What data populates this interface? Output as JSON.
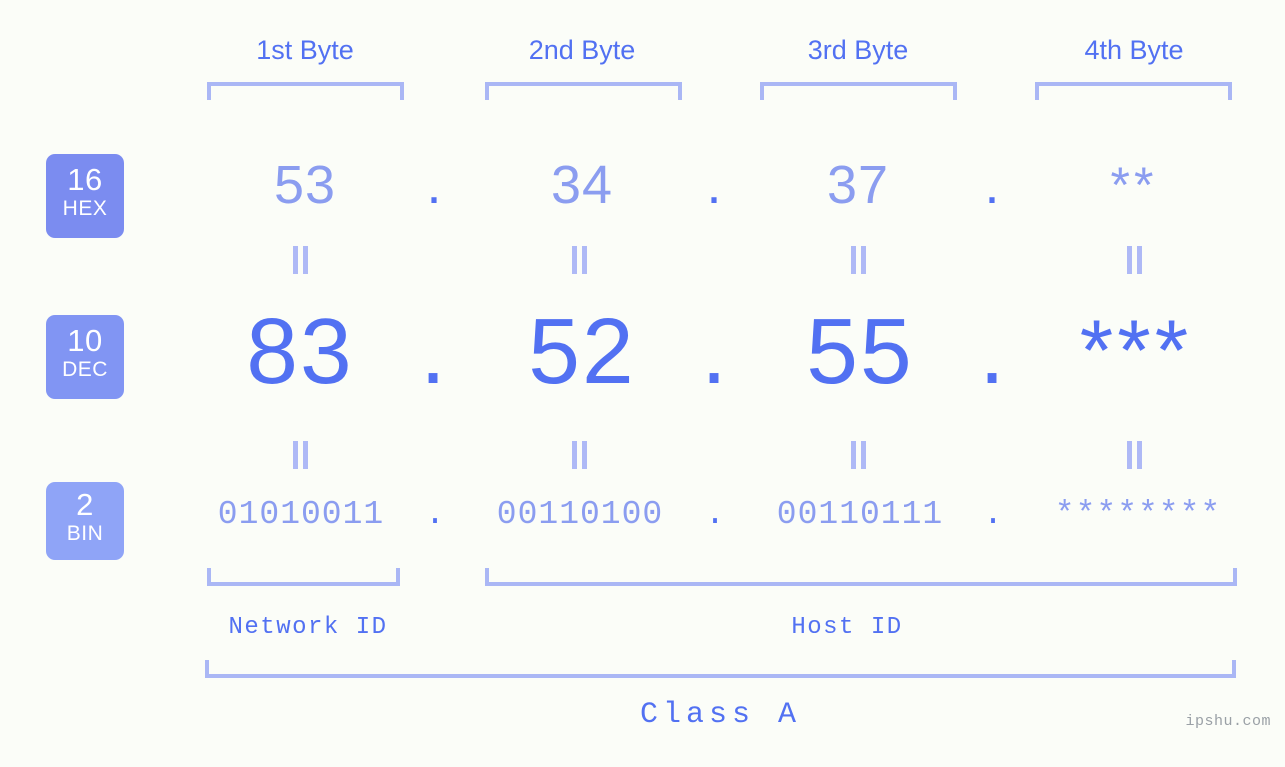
{
  "page": {
    "background_color": "#fbfdf8",
    "accent_color": "#5271f2",
    "accent_light_color": "#8b9df0",
    "bracket_color": "#aab7f5",
    "watermark": "ipshu.com"
  },
  "columns": [
    {
      "header": "1st Byte"
    },
    {
      "header": "2nd Byte"
    },
    {
      "header": "3rd Byte"
    },
    {
      "header": "4th Byte"
    }
  ],
  "bases": [
    {
      "number": "16",
      "name": "HEX",
      "badge_color": "#7b8cf0"
    },
    {
      "number": "10",
      "name": "DEC",
      "badge_color": "#8195f3"
    },
    {
      "number": "2",
      "name": "BIN",
      "badge_color": "#8fa4f7"
    }
  ],
  "rows": {
    "hex": {
      "values": [
        "53",
        "34",
        "37",
        "**"
      ],
      "separators": [
        ".",
        ".",
        "."
      ]
    },
    "dec": {
      "values": [
        "83",
        "52",
        "55",
        "***"
      ],
      "separators": [
        ".",
        ".",
        "."
      ]
    },
    "bin": {
      "values": [
        "01010011",
        "00110100",
        "00110111",
        "********"
      ],
      "separators": [
        ".",
        ".",
        "."
      ]
    }
  },
  "separators": {
    "equals": "="
  },
  "segments": {
    "network_id": "Network ID",
    "host_id": "Host ID",
    "class": "Class  A"
  }
}
